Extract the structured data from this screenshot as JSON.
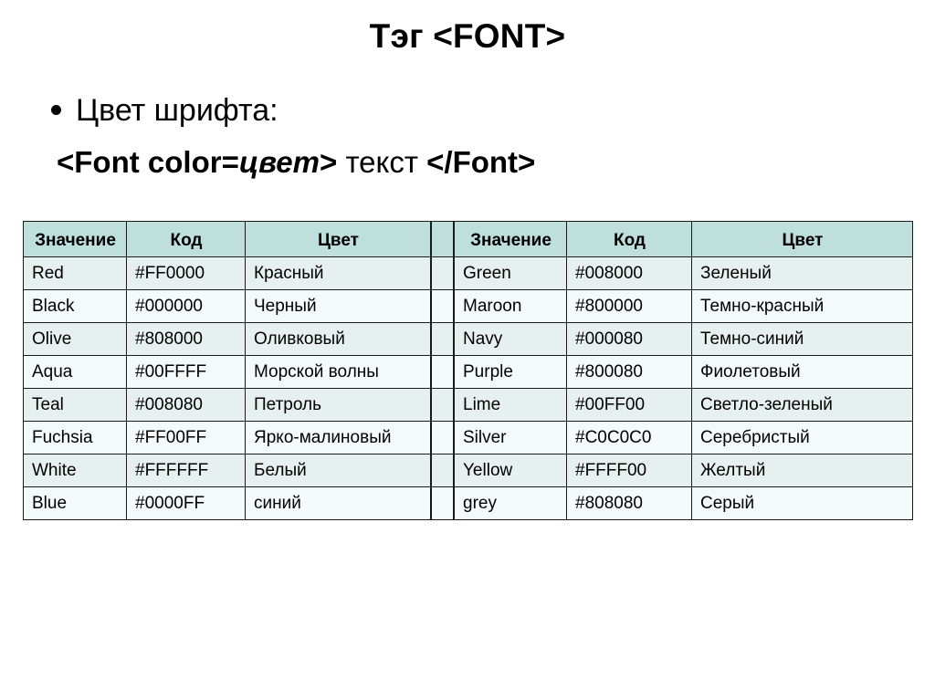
{
  "slide": {
    "title": "Тэг <FONT>",
    "bullet": {
      "marker": "bullet-dot",
      "text": "Цвет шрифта:"
    },
    "syntax": {
      "open_tag": "<Font color=",
      "value": "цвет",
      "close_bracket": ">",
      "content": "текст",
      "close_tag": "</Font>"
    }
  },
  "tables": {
    "header_bg": "#BFDFDD",
    "row_tint_bg": "#E5F0EF",
    "row_plain_bg": "#F4FAFA",
    "border_color": "#1A1A1A",
    "left": {
      "headers": [
        "Значение",
        "Код",
        "Цвет"
      ],
      "rows": [
        {
          "name": "Red",
          "code": "#FF0000",
          "color": "Красный"
        },
        {
          "name": "Black",
          "code": "#000000",
          "color": "Черный"
        },
        {
          "name": "Olive",
          "code": "#808000",
          "color": "Оливковый"
        },
        {
          "name": "Aqua",
          "code": "#00FFFF",
          "color": "Морской волны"
        },
        {
          "name": "Teal",
          "code": "#008080",
          "color": "Петроль"
        },
        {
          "name": "Fuchsia",
          "code": "#FF00FF",
          "color": "Ярко-малиновый"
        },
        {
          "name": "White",
          "code": "#FFFFFF",
          "color": "Белый"
        },
        {
          "name": "Blue",
          "code": "#0000FF",
          "color": "синий"
        }
      ]
    },
    "right": {
      "headers": [
        "Значение",
        "Код",
        "Цвет"
      ],
      "rows": [
        {
          "name": "Green",
          "code": "#008000",
          "color": "Зеленый"
        },
        {
          "name": "Maroon",
          "code": "#800000",
          "color": "Темно-красный"
        },
        {
          "name": "Navy",
          "code": "#000080",
          "color": "Темно-синий"
        },
        {
          "name": "Purple",
          "code": "#800080",
          "color": "Фиолетовый"
        },
        {
          "name": "Lime",
          "code": "#00FF00",
          "color": "Светло-зеленый"
        },
        {
          "name": "Silver",
          "code": "#C0C0C0",
          "color": "Серебристый"
        },
        {
          "name": "Yellow",
          "code": "#FFFF00",
          "color": "Желтый"
        },
        {
          "name": "grey",
          "code": "#808080",
          "color": "Серый"
        }
      ]
    }
  }
}
